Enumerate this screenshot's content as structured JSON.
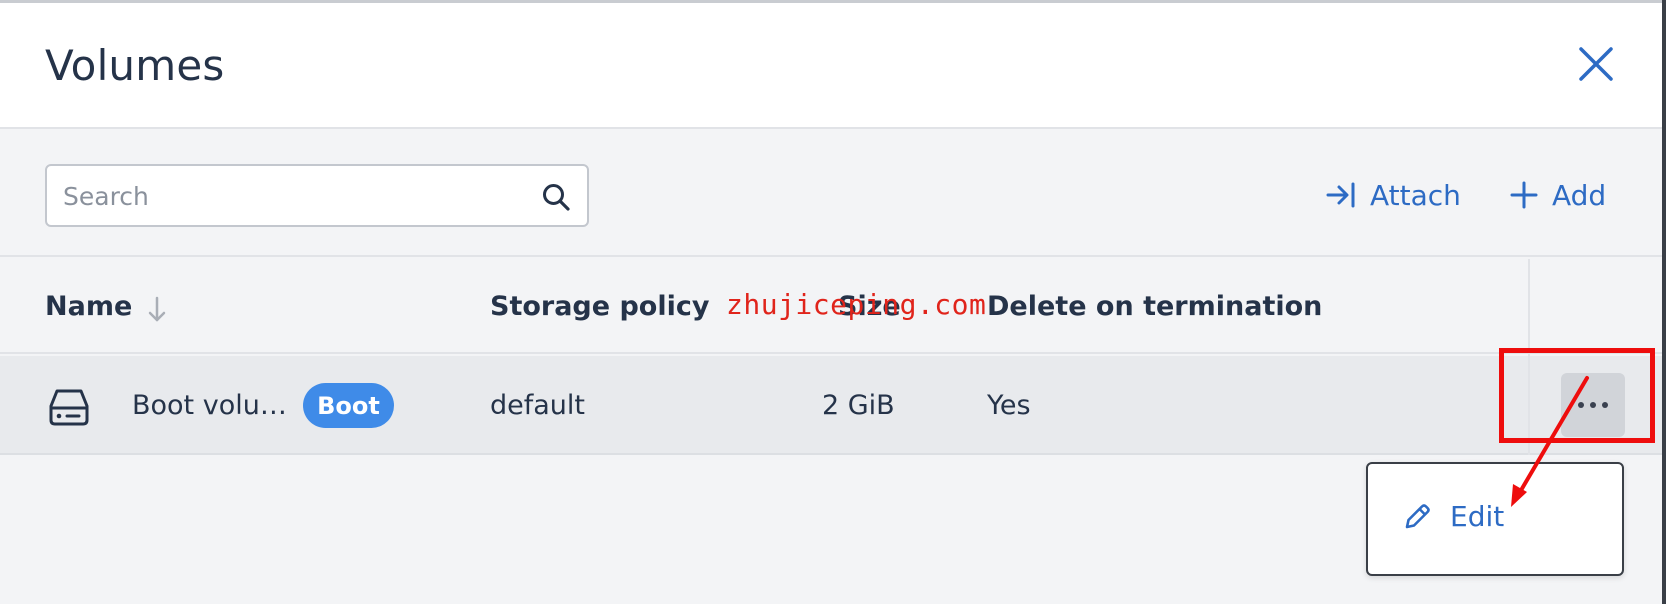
{
  "dialog": {
    "title": "Volumes"
  },
  "toolbar": {
    "search_placeholder": "Search",
    "search_value": "",
    "attach_label": "Attach",
    "add_label": "Add"
  },
  "table": {
    "columns": [
      "Name",
      "Storage policy",
      "Size",
      "Delete on termination"
    ],
    "rows": [
      {
        "name": "Boot volu…",
        "badge": "Boot",
        "storage_policy": "default",
        "size": "2 GiB",
        "delete_on_termination": "Yes"
      }
    ]
  },
  "context_menu": {
    "items": [
      {
        "label": "Edit",
        "icon": "pencil-icon"
      }
    ]
  },
  "annotations": {
    "watermark_text": "zhujiceping.com"
  },
  "colors": {
    "accent": "#2d6bc4",
    "badge": "#3f8be8",
    "annotation": "#ee0d0d"
  }
}
